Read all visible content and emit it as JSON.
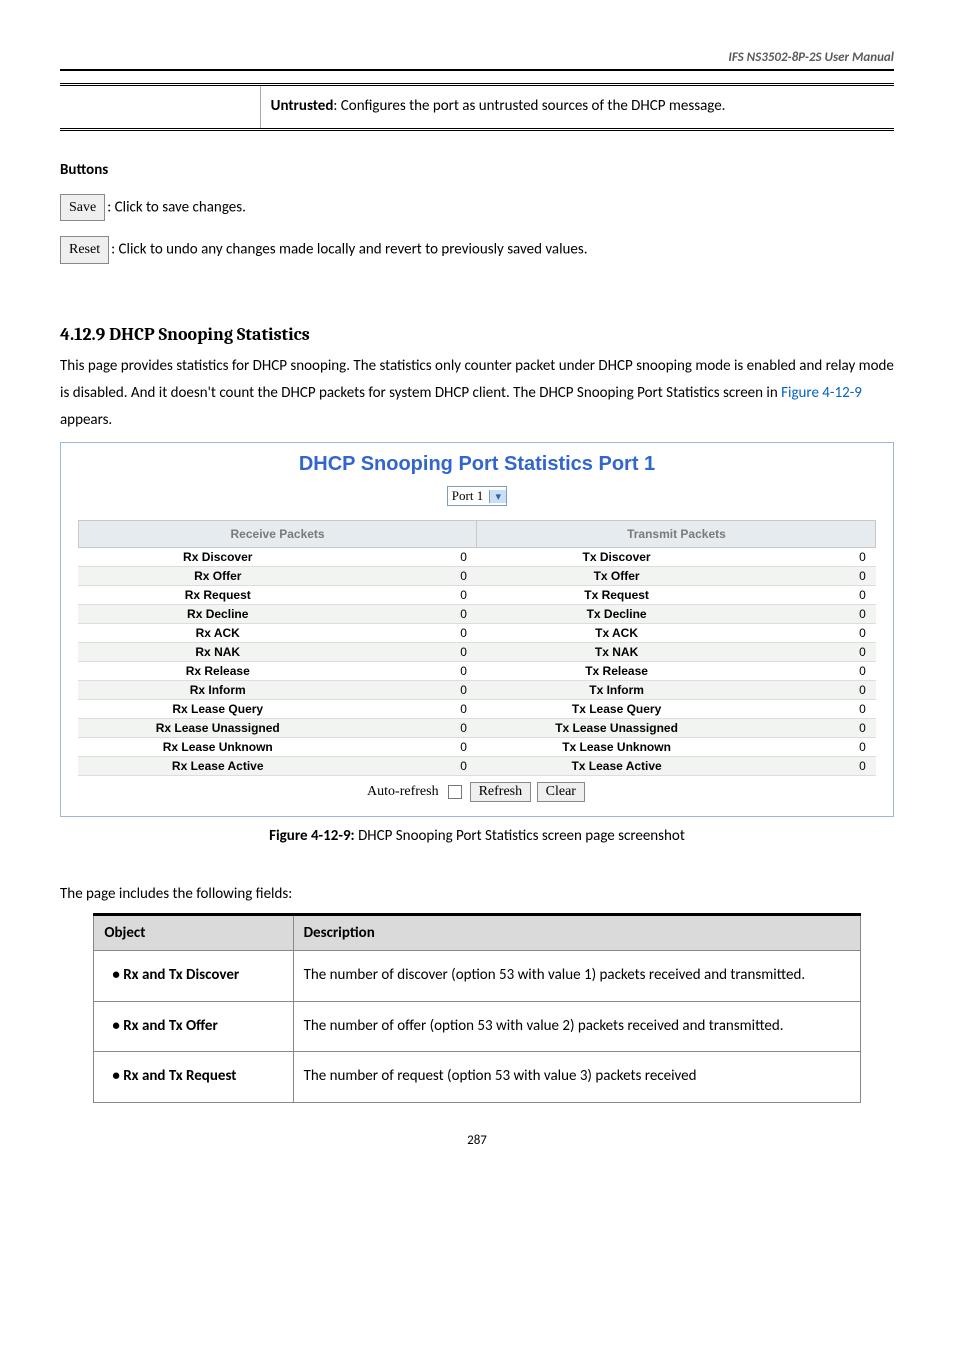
{
  "header": {
    "manual_title": "IFS  NS3502-8P-2S  User  Manual"
  },
  "untrusted": {
    "label_bold": "Untrusted",
    "text_rest": ": Configures the port as untrusted sources of the DHCP message."
  },
  "buttons_section": {
    "heading": "Buttons",
    "save_btn": "Save",
    "save_text": ": Click to save changes.",
    "reset_btn": "Reset",
    "reset_text": ": Click to undo any changes made locally and revert to previously saved values."
  },
  "section": {
    "title": "4.12.9 DHCP Snooping Statistics",
    "intro_a": "This page provides statistics for DHCP snooping. The statistics only counter packet under DHCP snooping mode is enabled and relay mode is disabled. And it doesn't count the DHCP packets for system DHCP client. The DHCP Snooping Port Statistics screen in ",
    "intro_link": "Figure 4-12-9",
    "intro_b": " appears."
  },
  "screenshot": {
    "title": "DHCP Snooping Port Statistics  Port 1",
    "port_selected": "Port 1",
    "col_rx": "Receive Packets",
    "col_tx": "Transmit Packets",
    "rows": [
      {
        "rx_label": "Rx Discover",
        "rx_val": "0",
        "tx_label": "Tx Discover",
        "tx_val": "0"
      },
      {
        "rx_label": "Rx Offer",
        "rx_val": "0",
        "tx_label": "Tx Offer",
        "tx_val": "0"
      },
      {
        "rx_label": "Rx Request",
        "rx_val": "0",
        "tx_label": "Tx Request",
        "tx_val": "0"
      },
      {
        "rx_label": "Rx Decline",
        "rx_val": "0",
        "tx_label": "Tx Decline",
        "tx_val": "0"
      },
      {
        "rx_label": "Rx ACK",
        "rx_val": "0",
        "tx_label": "Tx ACK",
        "tx_val": "0"
      },
      {
        "rx_label": "Rx NAK",
        "rx_val": "0",
        "tx_label": "Tx NAK",
        "tx_val": "0"
      },
      {
        "rx_label": "Rx Release",
        "rx_val": "0",
        "tx_label": "Tx Release",
        "tx_val": "0"
      },
      {
        "rx_label": "Rx Inform",
        "rx_val": "0",
        "tx_label": "Tx Inform",
        "tx_val": "0"
      },
      {
        "rx_label": "Rx Lease Query",
        "rx_val": "0",
        "tx_label": "Tx Lease Query",
        "tx_val": "0"
      },
      {
        "rx_label": "Rx Lease Unassigned",
        "rx_val": "0",
        "tx_label": "Tx Lease Unassigned",
        "tx_val": "0"
      },
      {
        "rx_label": "Rx Lease Unknown",
        "rx_val": "0",
        "tx_label": "Tx Lease Unknown",
        "tx_val": "0"
      },
      {
        "rx_label": "Rx Lease Active",
        "rx_val": "0",
        "tx_label": "Tx Lease Active",
        "tx_val": "0"
      }
    ],
    "auto_refresh_label": "Auto-refresh",
    "refresh_btn": "Refresh",
    "clear_btn": "Clear"
  },
  "figure_caption": {
    "bold": "Figure 4-12-9: ",
    "rest": "DHCP Snooping Port Statistics screen page screenshot"
  },
  "fields": {
    "intro": "The page includes the following fields:",
    "col_object": "Object",
    "col_desc": "Description",
    "rows": [
      {
        "obj": "Rx and Tx Discover",
        "desc": "The number of discover (option 53 with value 1) packets received and transmitted."
      },
      {
        "obj": "Rx and Tx Offer",
        "desc": "The number of offer (option 53 with value 2) packets received and transmitted."
      },
      {
        "obj": "Rx and Tx Request",
        "desc": "The number of request (option 53 with value 3) packets received"
      }
    ]
  },
  "page_number": "287"
}
